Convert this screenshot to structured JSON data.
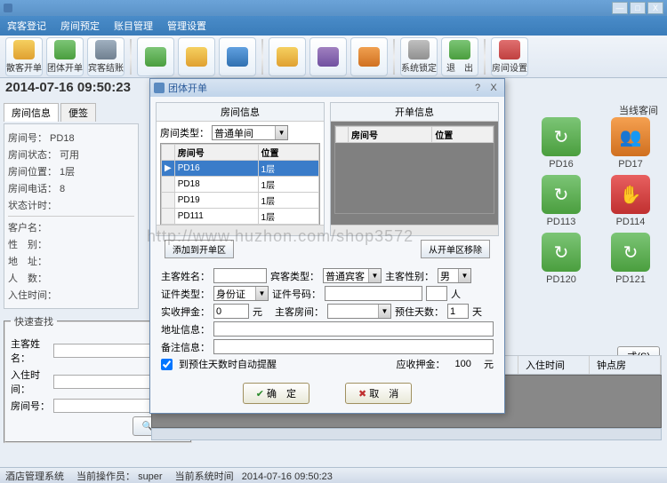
{
  "window": {
    "minimize": "—",
    "maximize": "□",
    "close": "X"
  },
  "menu": {
    "m1": "宾客登记",
    "m2": "房间预定",
    "m3": "账目管理",
    "m4": "管理设置"
  },
  "toolbar": {
    "b1": "散客开单",
    "b2": "团体开单",
    "b3": "宾客结账",
    "b4": "",
    "b5": "",
    "b6": "",
    "b7": "",
    "b8": "",
    "b9": "",
    "b10": "",
    "b11": "系统锁定",
    "b12": "退　出",
    "b13": "房间设置"
  },
  "datetime": "2014-07-16 09:50:23",
  "lefttabs": {
    "t1": "房间信息",
    "t2": "便签"
  },
  "roominfo": {
    "r1": "房间号：  PD18",
    "r2": "房间状态：  可用",
    "r3": "房间位置：  1层",
    "r4": "房间电话：  8",
    "r5": "状态计时：",
    "r6": "客户名：",
    "r7": "性　别：",
    "r8": "地　址：",
    "r9": "人　数：",
    "r10": "入住时间："
  },
  "search": {
    "legend": "快速查找",
    "l1": "主客姓名：",
    "l2": "入住时间：",
    "l3": "房间号：",
    "btn": "搜索"
  },
  "rightgrid": {
    "header": "当线客间",
    "r1": "PD16",
    "r2": "PD17",
    "r3": "PD113",
    "r4": "PD114",
    "r5": "PD120",
    "r6": "PD121"
  },
  "stylebtn": "式(S)",
  "listcols": {
    "c1": "入住时间",
    "c2": "钟点房"
  },
  "modal": {
    "title": "团体开单",
    "help": "?",
    "close": "X",
    "panel1": "房间信息",
    "panel2": "开单信息",
    "typelabel": "房间类型：",
    "typeval": "普通单间",
    "gridcols": {
      "c0": "",
      "c1": "房间号",
      "c2": "位置"
    },
    "rows": [
      {
        "id": "PD16",
        "loc": "1层"
      },
      {
        "id": "PD18",
        "loc": "1层"
      },
      {
        "id": "PD19",
        "loc": "1层"
      },
      {
        "id": "PD111",
        "loc": "1层"
      }
    ],
    "gridcols2": {
      "c1": "房间号",
      "c2": "位置"
    },
    "addbtn": "添加到开单区",
    "rembtn": "从开单区移除",
    "f": {
      "guestname": "主客姓名：",
      "guesttype": "宾客类型：",
      "guesttypeval": "普通宾客",
      "gender": "主客性别：",
      "genderval": "男",
      "idtype": "证件类型：",
      "idtypeval": "身份证",
      "idno": "证件号码：",
      "people_suffix": "人",
      "deposit": "实收押金：",
      "depositval": "0",
      "yuan": "元",
      "mainroom": "主客房间：",
      "days": "预住天数：",
      "daysval": "1",
      "day": "天",
      "addr": "地址信息：",
      "note": "备注信息：",
      "autochk": "到预住天数时自动提醒",
      "shoulddep": "应收押金：",
      "shoulddepval": "100"
    },
    "ok": "确　定",
    "cancel": "取　消"
  },
  "statusbar": {
    "s1": "酒店管理系统",
    "s2": "当前操作员：",
    "s2v": "super",
    "s3": "当前系统时间",
    "s3v": "2014-07-16 09:50:23"
  },
  "watermark": "http://www.huzhon.com/shop3572"
}
